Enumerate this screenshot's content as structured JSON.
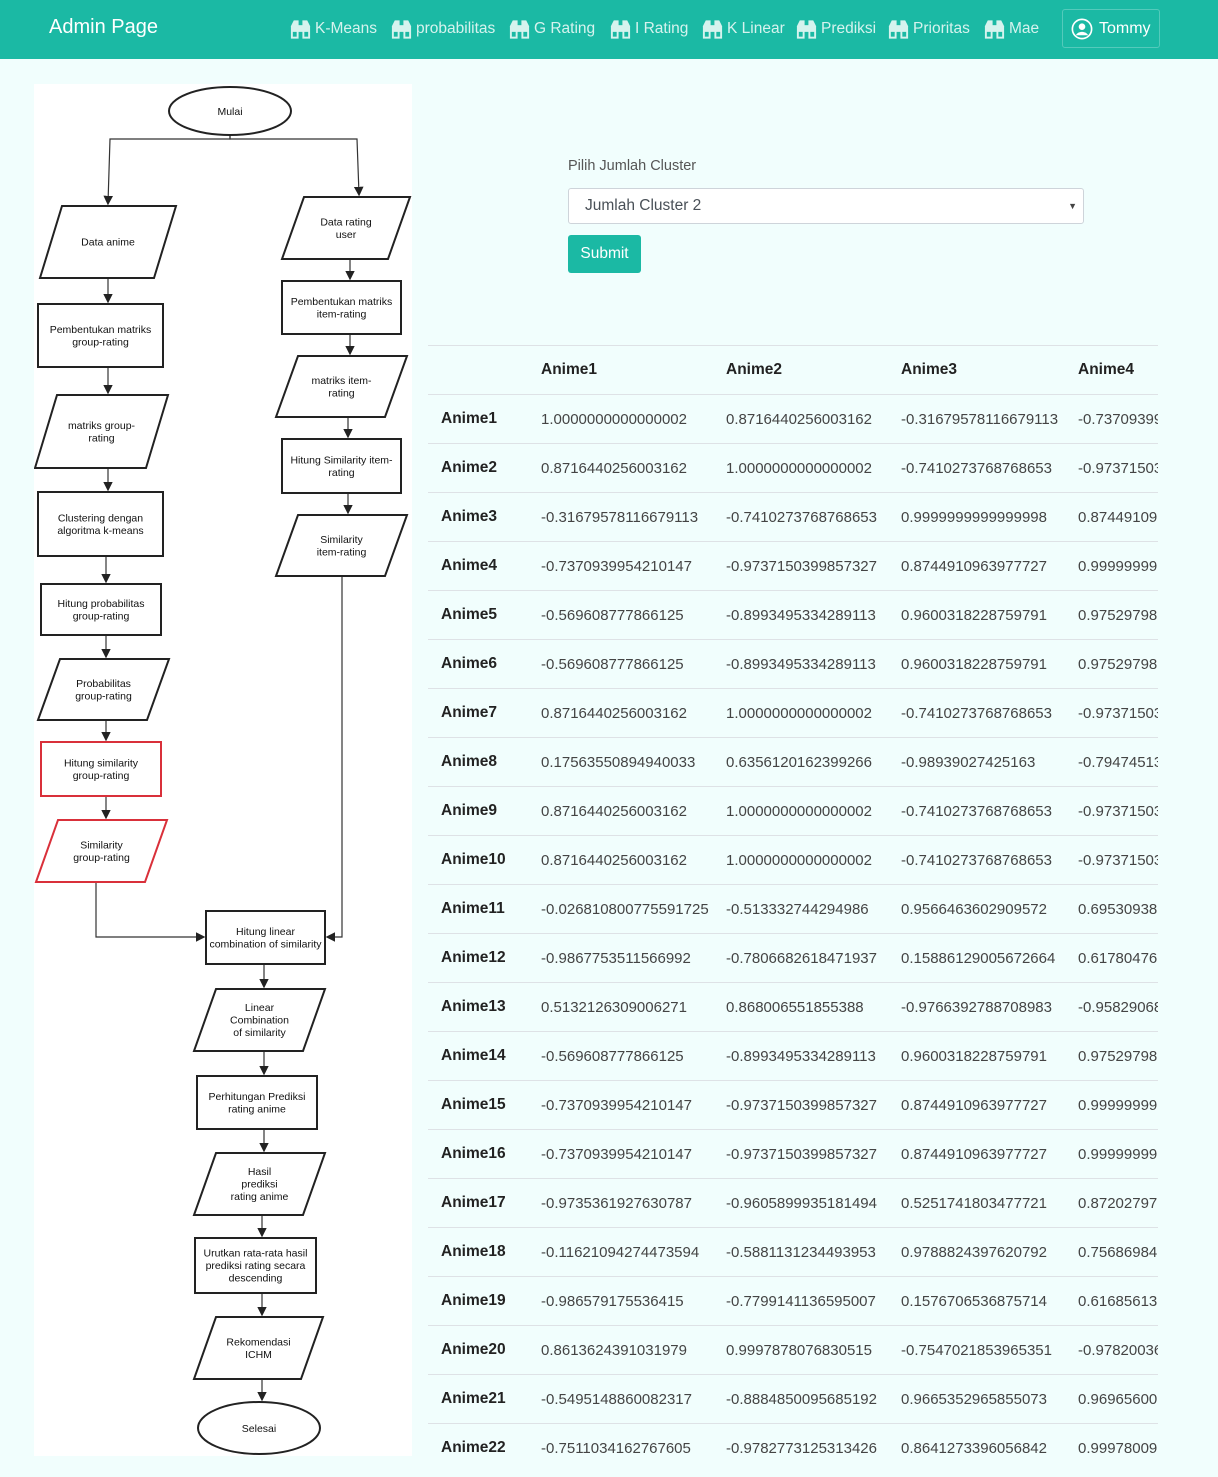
{
  "navbar": {
    "brand": "Admin Page",
    "items": [
      {
        "label": "K-Means",
        "icon": "binoculars-icon"
      },
      {
        "label": "probabilitas",
        "icon": "binoculars-icon"
      },
      {
        "label": "G Rating",
        "icon": "binoculars-icon"
      },
      {
        "label": "I Rating",
        "icon": "binoculars-icon"
      },
      {
        "label": "K Linear",
        "icon": "binoculars-icon"
      },
      {
        "label": "Prediksi",
        "icon": "binoculars-icon"
      },
      {
        "label": "Prioritas",
        "icon": "binoculars-icon"
      },
      {
        "label": "Mae",
        "icon": "binoculars-icon"
      }
    ],
    "user": {
      "name": "Tommy",
      "icon": "user-circle-icon"
    }
  },
  "form": {
    "label": "Pilih Jumlah Cluster",
    "selected": "Jumlah Cluster 2",
    "submit": "Submit"
  },
  "flowchart": {
    "start": "Mulai",
    "left": [
      [
        "Data anime"
      ],
      [
        "Pembentukan matriks",
        "group-rating"
      ],
      [
        "matriks group-",
        "rating"
      ],
      [
        "Clustering dengan",
        "algoritma k-means"
      ],
      [
        "Hitung probabilitas",
        "group-rating"
      ],
      [
        "Probabilitas",
        "group-rating"
      ],
      [
        "Hitung similarity",
        "group-rating"
      ],
      [
        "Similarity",
        "group-rating"
      ]
    ],
    "right": [
      [
        "Data rating",
        "user"
      ],
      [
        "Pembentukan matriks",
        "item-rating"
      ],
      [
        "matriks item-",
        "rating"
      ],
      [
        "Hitung Similarity item-",
        "rating"
      ],
      [
        "Similarity",
        "item-rating"
      ]
    ],
    "bottom": [
      [
        "Hitung linear",
        "combination of similarity"
      ],
      [
        "Linear",
        "Combination",
        "of similarity"
      ],
      [
        "Perhitungan Prediksi",
        "rating anime"
      ],
      [
        "Hasil",
        "prediksi",
        "rating anime"
      ],
      [
        "Urutkan rata-rata hasil",
        "prediksi rating secara",
        "descending"
      ],
      [
        "Rekomendasi",
        "ICHM"
      ]
    ],
    "end": "Selesai"
  },
  "table": {
    "headers": [
      "",
      "Anime1",
      "Anime2",
      "Anime3",
      "Anime4"
    ],
    "rows": [
      [
        "Anime1",
        "1.0000000000000002",
        "0.8716440256003162",
        "-0.31679578116679113",
        "-0.73709399"
      ],
      [
        "Anime2",
        "0.8716440256003162",
        "1.0000000000000002",
        "-0.7410273768768653",
        "-0.97371503"
      ],
      [
        "Anime3",
        "-0.31679578116679113",
        "-0.7410273768768653",
        "0.9999999999999998",
        "0.874491096"
      ],
      [
        "Anime4",
        "-0.7370939954210147",
        "-0.9737150399857327",
        "0.8744910963977727",
        "0.99999999"
      ],
      [
        "Anime5",
        "-0.569608777866125",
        "-0.8993495334289113",
        "0.9600318228759791",
        "0.97529798"
      ],
      [
        "Anime6",
        "-0.569608777866125",
        "-0.8993495334289113",
        "0.9600318228759791",
        "0.97529798"
      ],
      [
        "Anime7",
        "0.8716440256003162",
        "1.0000000000000002",
        "-0.7410273768768653",
        "-0.97371503"
      ],
      [
        "Anime8",
        "0.17563550894940033",
        "0.6356120162399266",
        "-0.98939027425163",
        "-0.79474513"
      ],
      [
        "Anime9",
        "0.8716440256003162",
        "1.0000000000000002",
        "-0.7410273768768653",
        "-0.97371503"
      ],
      [
        "Anime10",
        "0.8716440256003162",
        "1.0000000000000002",
        "-0.7410273768768653",
        "-0.97371503"
      ],
      [
        "Anime11",
        "-0.026810800775591725",
        "-0.513332744294986",
        "0.9566463602909572",
        "0.69530938"
      ],
      [
        "Anime12",
        "-0.9867753511566992",
        "-0.7806682618471937",
        "0.15886129005672664",
        "0.61780476"
      ],
      [
        "Anime13",
        "0.5132126309006271",
        "0.868006551855388",
        "-0.9766392788708983",
        "-0.95829068"
      ],
      [
        "Anime14",
        "-0.569608777866125",
        "-0.8993495334289113",
        "0.9600318228759791",
        "0.97529798"
      ],
      [
        "Anime15",
        "-0.7370939954210147",
        "-0.9737150399857327",
        "0.8744910963977727",
        "0.99999999"
      ],
      [
        "Anime16",
        "-0.7370939954210147",
        "-0.9737150399857327",
        "0.8744910963977727",
        "0.99999999"
      ],
      [
        "Anime17",
        "-0.9735361927630787",
        "-0.9605899935181494",
        "0.5251741803477721",
        "0.87202797"
      ],
      [
        "Anime18",
        "-0.11621094274473594",
        "-0.5881131234493953",
        "0.9788824397620792",
        "0.75686984"
      ],
      [
        "Anime19",
        "-0.986579175536415",
        "-0.7799141136595007",
        "0.1576706536875714",
        "0.616856131"
      ],
      [
        "Anime20",
        "0.8613624391031979",
        "0.9997878076830515",
        "-0.7547021853965351",
        "-0.97820036"
      ],
      [
        "Anime21",
        "-0.5495148860082317",
        "-0.8884850095685192",
        "0.9665352965855073",
        "0.96965600"
      ],
      [
        "Anime22",
        "-0.7511034162767605",
        "-0.9782773125313426",
        "0.8641273396056842",
        "0.99978009"
      ]
    ]
  }
}
